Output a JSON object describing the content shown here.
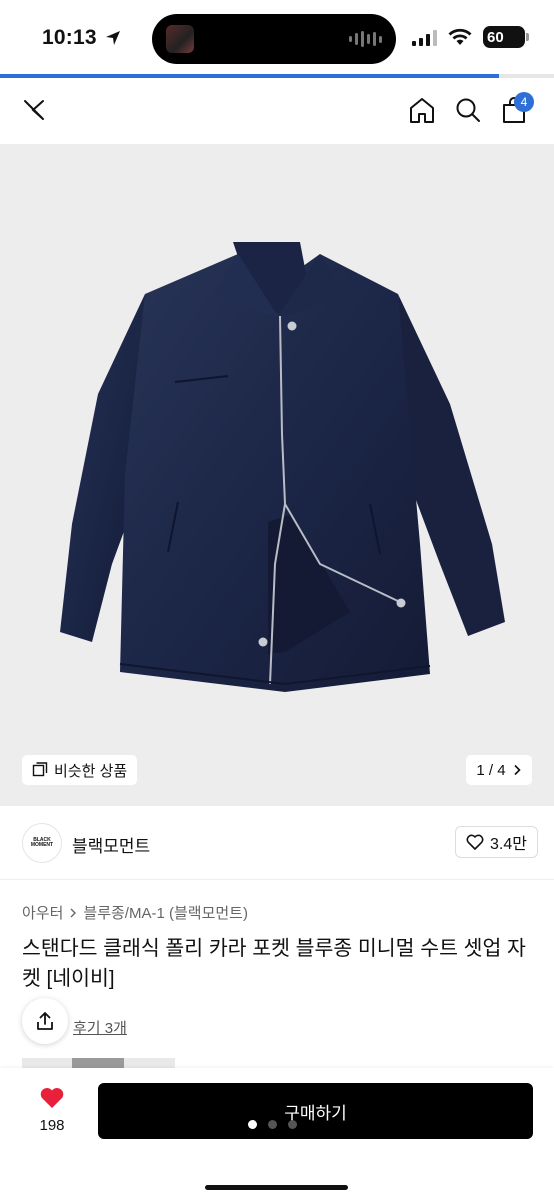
{
  "status_bar": {
    "time": "10:13",
    "battery": "60"
  },
  "progress": {
    "value_percent": 90,
    "color": "#2d6fd6"
  },
  "nav": {
    "cart_count": "4",
    "icons": [
      "close-icon",
      "home-icon",
      "search-icon",
      "cart-icon"
    ]
  },
  "image": {
    "similar_label": "비슷한 상품",
    "page_indicator": "1 / 4"
  },
  "brand": {
    "logo_text": "BLACK MOMENT",
    "name": "블랙모먼트",
    "like_count": "3.4만"
  },
  "breadcrumb": {
    "category": "아우터",
    "subcategory": "블루종/MA-1 (블랙모먼트)"
  },
  "product": {
    "title": "스탠다드 클래식 폴리 카라 포켓 블루종 미니멀 수트 셋업 자켓 [네이비]",
    "review_link": "후기 3개"
  },
  "bottom": {
    "heart_count": "198",
    "buy_label": "구매하기",
    "accent_heart": "#e8203a"
  }
}
